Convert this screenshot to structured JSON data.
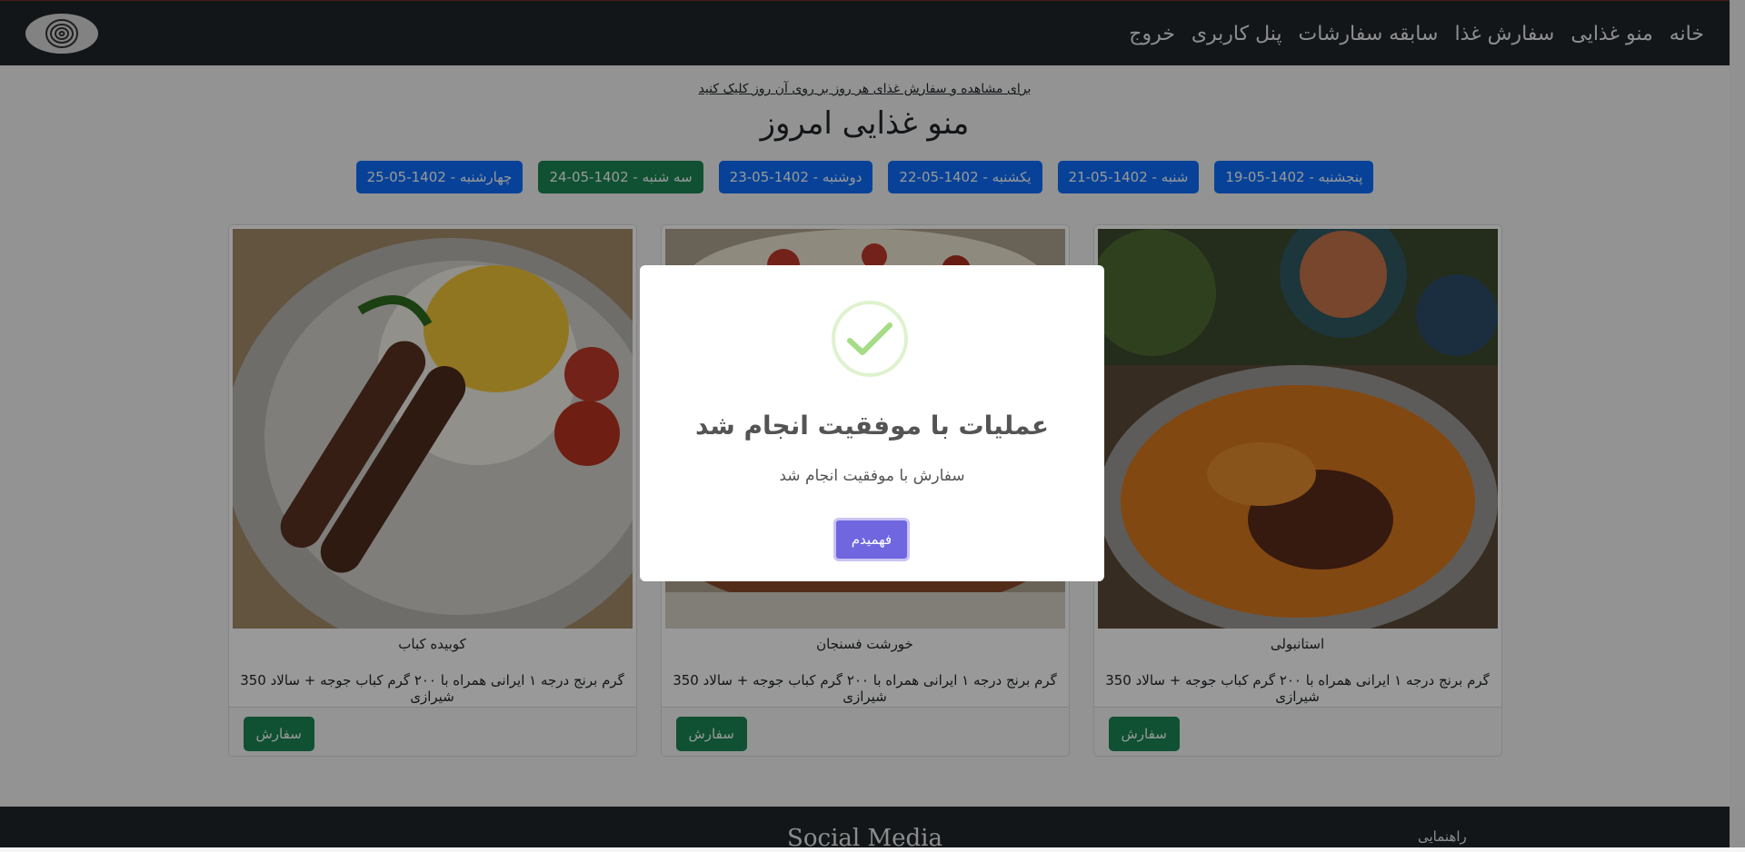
{
  "navbar": {
    "links": [
      "خانه",
      "منو غذایی",
      "سفارش غذا",
      "سابقه سفارشات",
      "پنل کاربری",
      "خروج"
    ]
  },
  "page": {
    "hint": "برای مشاهده و سفارش غذای هر روز بر روی آن روز کلیک کنید",
    "title": "منو غذایی امروز"
  },
  "days": [
    {
      "label": "پنجشنبه - 1402-05-19",
      "active": false
    },
    {
      "label": "شنبه - 1402-05-21",
      "active": false
    },
    {
      "label": "یکشنبه - 1402-05-22",
      "active": false
    },
    {
      "label": "دوشنبه - 1402-05-23",
      "active": false
    },
    {
      "label": "سه شنبه - 1402-05-24",
      "active": true
    },
    {
      "label": "چهارشنبه - 1402-05-25",
      "active": false
    }
  ],
  "cards": [
    {
      "name": "استانبولی",
      "description": "350 گرم برنج درجه ۱ ایرانی همراه با ۲۰۰ گرم کباب جوجه + سالاد شیرازی",
      "button": "سفارش"
    },
    {
      "name": "خورشت فسنجان",
      "description": "350 گرم برنج درجه ۱ ایرانی همراه با ۲۰۰ گرم کباب جوجه + سالاد شیرازی",
      "button": "سفارش"
    },
    {
      "name": "کوبیده کباب",
      "description": "350 گرم برنج درجه ۱ ایرانی همراه با ۲۰۰ گرم کباب جوجه + سالاد شیرازی",
      "button": "سفارش"
    }
  ],
  "footer": {
    "title": "Social Media",
    "help": "راهنمایی"
  },
  "modal": {
    "title": "عملیات با موفقیت انجام شد",
    "text": "سفارش با موفقیت انجام شد",
    "confirm": "فهمیدم"
  },
  "colors": {
    "navbar": "#212529",
    "primary": "#0d6efd",
    "success": "#198754",
    "confirm": "#7066e0",
    "check": "#a5dc86"
  }
}
